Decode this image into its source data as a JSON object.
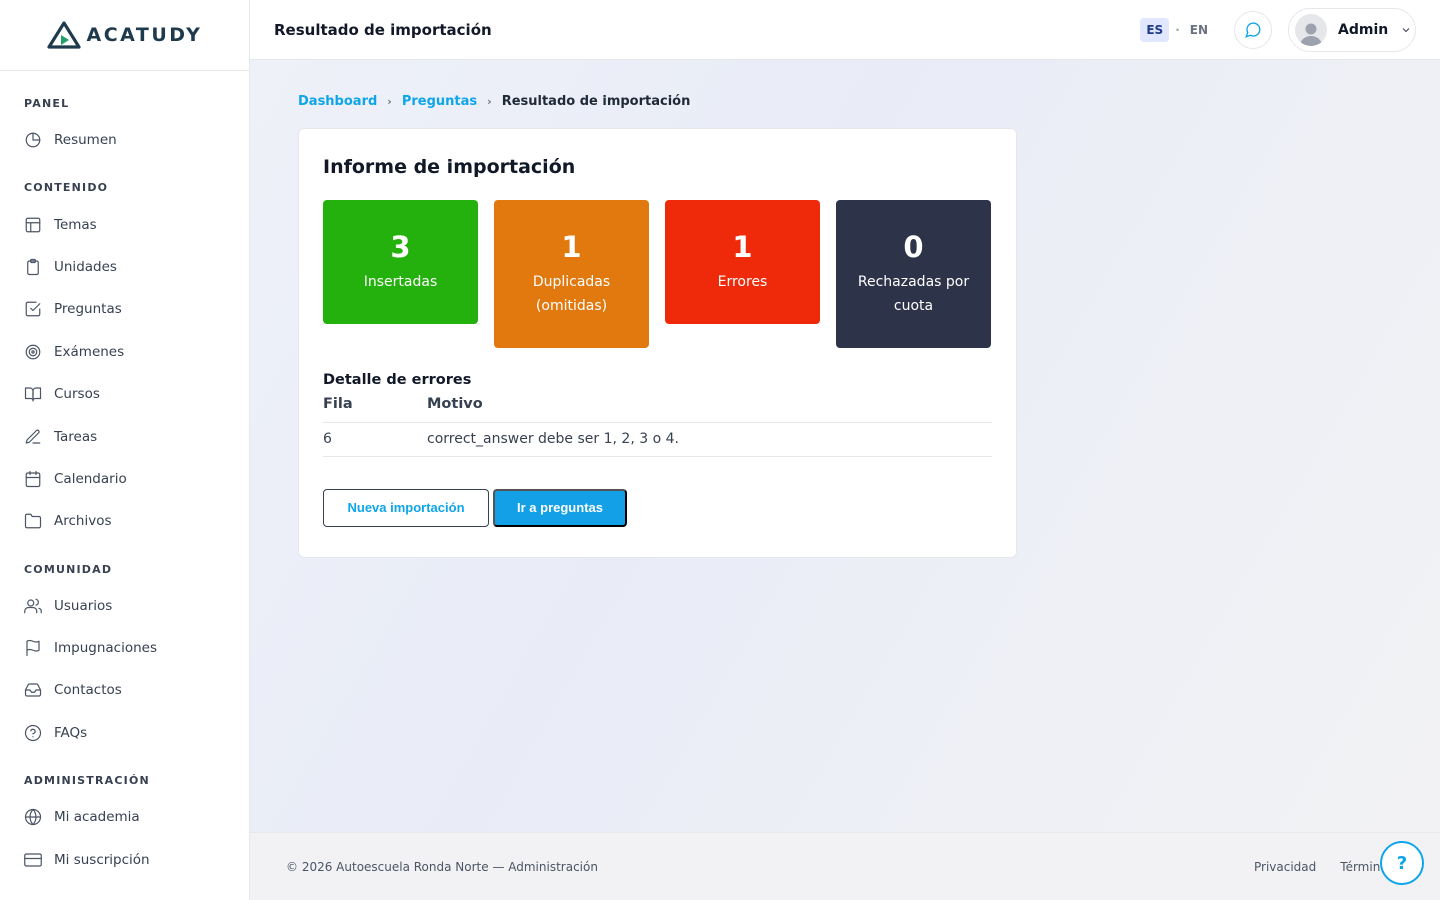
{
  "brand": {
    "name": "ACATUDY"
  },
  "sidebar": {
    "sections": [
      {
        "title": "PANEL",
        "items": [
          {
            "label": "Resumen",
            "icon": "pie-chart-icon"
          }
        ]
      },
      {
        "title": "CONTENIDO",
        "items": [
          {
            "label": "Temas",
            "icon": "layout-icon"
          },
          {
            "label": "Unidades",
            "icon": "clipboard-icon"
          },
          {
            "label": "Preguntas",
            "icon": "check-square-icon"
          },
          {
            "label": "Exámenes",
            "icon": "target-icon"
          },
          {
            "label": "Cursos",
            "icon": "book-open-icon"
          },
          {
            "label": "Tareas",
            "icon": "pen-icon"
          },
          {
            "label": "Calendario",
            "icon": "calendar-icon"
          },
          {
            "label": "Archivos",
            "icon": "folder-icon"
          }
        ]
      },
      {
        "title": "COMUNIDAD",
        "items": [
          {
            "label": "Usuarios",
            "icon": "users-icon"
          },
          {
            "label": "Impugnaciones",
            "icon": "flag-icon"
          },
          {
            "label": "Contactos",
            "icon": "inbox-icon"
          },
          {
            "label": "FAQs",
            "icon": "help-circle-icon"
          }
        ]
      },
      {
        "title": "ADMINISTRACIÓN",
        "items": [
          {
            "label": "Mi academia",
            "icon": "globe-icon"
          },
          {
            "label": "Mi suscripción",
            "icon": "credit-card-icon"
          }
        ]
      }
    ]
  },
  "header": {
    "title": "Resultado de importación",
    "lang_active": "ES",
    "lang_sep": "·",
    "lang_other": "EN",
    "user_name": "Admin"
  },
  "breadcrumb": {
    "items": [
      "Dashboard",
      "Preguntas"
    ],
    "current": "Resultado de importación",
    "separator": "›"
  },
  "report": {
    "title": "Informe de importación",
    "stats": [
      {
        "value": "3",
        "label": "Insertadas",
        "color": "#25b10d"
      },
      {
        "value": "1",
        "label": "Duplicadas (omitidas)",
        "color": "#e2790e"
      },
      {
        "value": "1",
        "label": "Errores",
        "color": "#ee2a0a"
      },
      {
        "value": "0",
        "label": "Rechazadas por cuota",
        "color": "#2d3349"
      }
    ],
    "errors_title": "Detalle de errores",
    "errors_headers": [
      "Fila",
      "Motivo"
    ],
    "errors_rows": [
      [
        "6",
        "correct_answer debe ser 1, 2, 3 o 4."
      ]
    ],
    "btn_new": "Nueva importación",
    "btn_go": "Ir a preguntas"
  },
  "footer": {
    "copyright": "© 2026 Autoescuela Ronda Norte — Administración",
    "links": [
      "Privacidad",
      "Términos"
    ],
    "help": "?"
  },
  "colors": {
    "accent": "#0ea5e9",
    "primary_button": "#14a0e6"
  }
}
